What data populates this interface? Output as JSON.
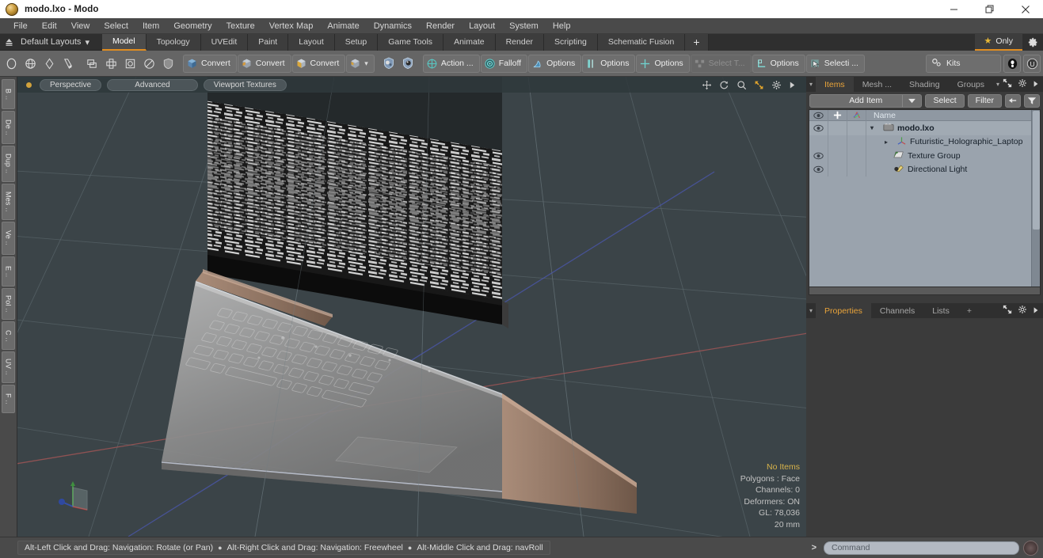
{
  "window": {
    "title": "modo.lxo - Modo",
    "app_icon": "modo-logo-icon",
    "minimize": "–",
    "maximize": "❐",
    "close": "✕"
  },
  "menubar": {
    "items": [
      {
        "label": "File"
      },
      {
        "label": "Edit"
      },
      {
        "label": "View"
      },
      {
        "label": "Select"
      },
      {
        "label": "Item"
      },
      {
        "label": "Geometry"
      },
      {
        "label": "Texture"
      },
      {
        "label": "Vertex Map"
      },
      {
        "label": "Animate"
      },
      {
        "label": "Dynamics"
      },
      {
        "label": "Render"
      },
      {
        "label": "Layout"
      },
      {
        "label": "System"
      },
      {
        "label": "Help"
      }
    ]
  },
  "layoutbar": {
    "default_layouts_label": "Default Layouts",
    "default_layouts_caret": "▾",
    "tabs": [
      {
        "label": "Model",
        "active": true
      },
      {
        "label": "Topology",
        "active": false
      },
      {
        "label": "UVEdit",
        "active": false
      },
      {
        "label": "Paint",
        "active": false
      },
      {
        "label": "Layout",
        "active": false
      },
      {
        "label": "Setup",
        "active": false
      },
      {
        "label": "Game Tools",
        "active": false
      },
      {
        "label": "Animate",
        "active": false
      },
      {
        "label": "Render",
        "active": false
      },
      {
        "label": "Scripting",
        "active": false
      },
      {
        "label": "Schematic Fusion",
        "active": false
      }
    ],
    "add_tab_label": "+",
    "only_label": "Only",
    "only_star": "★",
    "accent_color": "#e08c20"
  },
  "toolbar": {
    "mode_icons": [
      {
        "name": "vertices-mode-icon"
      },
      {
        "name": "edges-mode-icon"
      },
      {
        "name": "polygons-mode-icon"
      },
      {
        "name": "materials-mode-icon"
      }
    ],
    "selection_icons": [
      {
        "name": "item-mode-icon"
      },
      {
        "name": "center-mode-icon"
      },
      {
        "name": "pivot-mode-icon"
      },
      {
        "name": "snap-mode-icon"
      }
    ],
    "shield_icon": "fallback-shield-icon",
    "convert_buttons": [
      {
        "label": "Convert",
        "icon": "convert-blue-icon"
      },
      {
        "label": "Convert",
        "icon": "convert-orange-icon"
      },
      {
        "label": "Convert",
        "icon": "convert-yellow-icon"
      }
    ],
    "cube_dropdown": {
      "icon": "cube-icon",
      "caret": "▾"
    },
    "paint_icons": [
      {
        "name": "paint-bucket-icon"
      },
      {
        "name": "color-picker-icon"
      }
    ],
    "option_buttons": [
      {
        "label": "Action  ...",
        "icon": "action-center-icon",
        "dim": false
      },
      {
        "label": "Falloff",
        "icon": "falloff-icon",
        "dim": false
      },
      {
        "label": "Options",
        "icon": "tool-options-icon",
        "dim": false
      },
      {
        "label": "Options",
        "icon": "symmetry-options-icon",
        "dim": false
      },
      {
        "label": "Options",
        "icon": "snap-options-icon",
        "dim": false
      },
      {
        "label": "Select T...",
        "icon": "select-through-icon",
        "dim": true
      },
      {
        "label": "Options",
        "icon": "workplane-options-icon",
        "dim": false
      },
      {
        "label": "Selecti ...",
        "icon": "selection-set-icon",
        "dim": false
      }
    ],
    "kits_label": "Kits",
    "kits_icon": "kits-gear-icon",
    "right_icons": [
      {
        "name": "preset-browser-icon"
      },
      {
        "name": "modo-u-icon"
      }
    ]
  },
  "left_strip": {
    "tabs": [
      "B ..",
      "De ..",
      "Dup ..",
      "Mes ..",
      "Ve ..",
      "E ..",
      "Pol ..",
      "C ..",
      "UV ..",
      "F .."
    ]
  },
  "viewport": {
    "header": {
      "indicator": "active-viewport-dot",
      "pills": [
        "Perspective",
        "Advanced",
        "Viewport Textures"
      ],
      "tool_icons": [
        {
          "name": "pan-icon"
        },
        {
          "name": "rotate-icon"
        },
        {
          "name": "zoom-icon"
        },
        {
          "name": "fit-icon"
        },
        {
          "name": "viewport-gear-icon"
        },
        {
          "name": "viewport-more-arrow-icon"
        }
      ]
    },
    "stats": {
      "no_items": "No Items",
      "polygons": "Polygons : Face",
      "channels": "Channels: 0",
      "deformers": "Deformers: ON",
      "gl": "GL: 78,036",
      "grid_size": "20 mm"
    },
    "axis_gizmo": "axis-gizmo-icon",
    "background_color": "#3b4448",
    "grid_color": "#566166",
    "x_axis_color": "#a05a5a",
    "z_axis_color": "#4c57a8"
  },
  "right_panel": {
    "top_tabs": [
      {
        "label": "Items",
        "active": true
      },
      {
        "label": "Mesh ...",
        "active": false
      },
      {
        "label": "Shading",
        "active": false
      },
      {
        "label": "Groups",
        "active": false
      }
    ],
    "top_tab_caret": "▾",
    "top_tab_icons": [
      {
        "name": "popout-panel-icon"
      },
      {
        "name": "panel-gear-icon"
      },
      {
        "name": "panel-more-arrow-icon"
      }
    ],
    "items_toolrow": {
      "add_item_label": "Add Item",
      "add_item_caret": "▾",
      "select_label": "Select",
      "filter_label": "Filter",
      "collapse_icon": "collapse-arrow-icon",
      "filter_icon": "funnel-icon"
    },
    "list_columns": [
      {
        "name": "visibility-eye-icon"
      },
      {
        "name": "lock-plus-icon"
      },
      {
        "name": "shading-icon"
      },
      {
        "label": "Name"
      }
    ],
    "items": [
      {
        "name": "modo.lxo",
        "icon": "scene-icon",
        "depth": 0,
        "eye": true,
        "expander": "▾",
        "root": true
      },
      {
        "name": "Futuristic_Holographic_Laptop",
        "icon": "mesh-icon",
        "depth": 1,
        "eye": false,
        "expander": "▸",
        "root": false
      },
      {
        "name": "Texture Group",
        "icon": "texture-group-icon",
        "depth": 1,
        "eye": true,
        "expander": "",
        "root": false
      },
      {
        "name": "Directional Light",
        "icon": "light-icon",
        "depth": 1,
        "eye": true,
        "expander": "",
        "root": false
      }
    ],
    "bottom_tabs": [
      {
        "label": "Properties",
        "active": true
      },
      {
        "label": "Channels",
        "active": false
      },
      {
        "label": "Lists",
        "active": false
      },
      {
        "label": "+",
        "active": false
      }
    ],
    "bottom_tab_icons": [
      {
        "name": "popout-panel-icon"
      },
      {
        "name": "panel-gear-icon"
      },
      {
        "name": "panel-more-arrow-icon"
      }
    ]
  },
  "statusbar": {
    "hints": [
      "Alt-Left Click and Drag: Navigation: Rotate (or Pan)",
      "Alt-Right Click and Drag: Navigation: Freewheel",
      "Alt-Middle Click and Drag: navRoll"
    ],
    "bullet": "●",
    "command_arrow": ">",
    "command_placeholder": "Command",
    "command_record_icon": "record-icon"
  }
}
